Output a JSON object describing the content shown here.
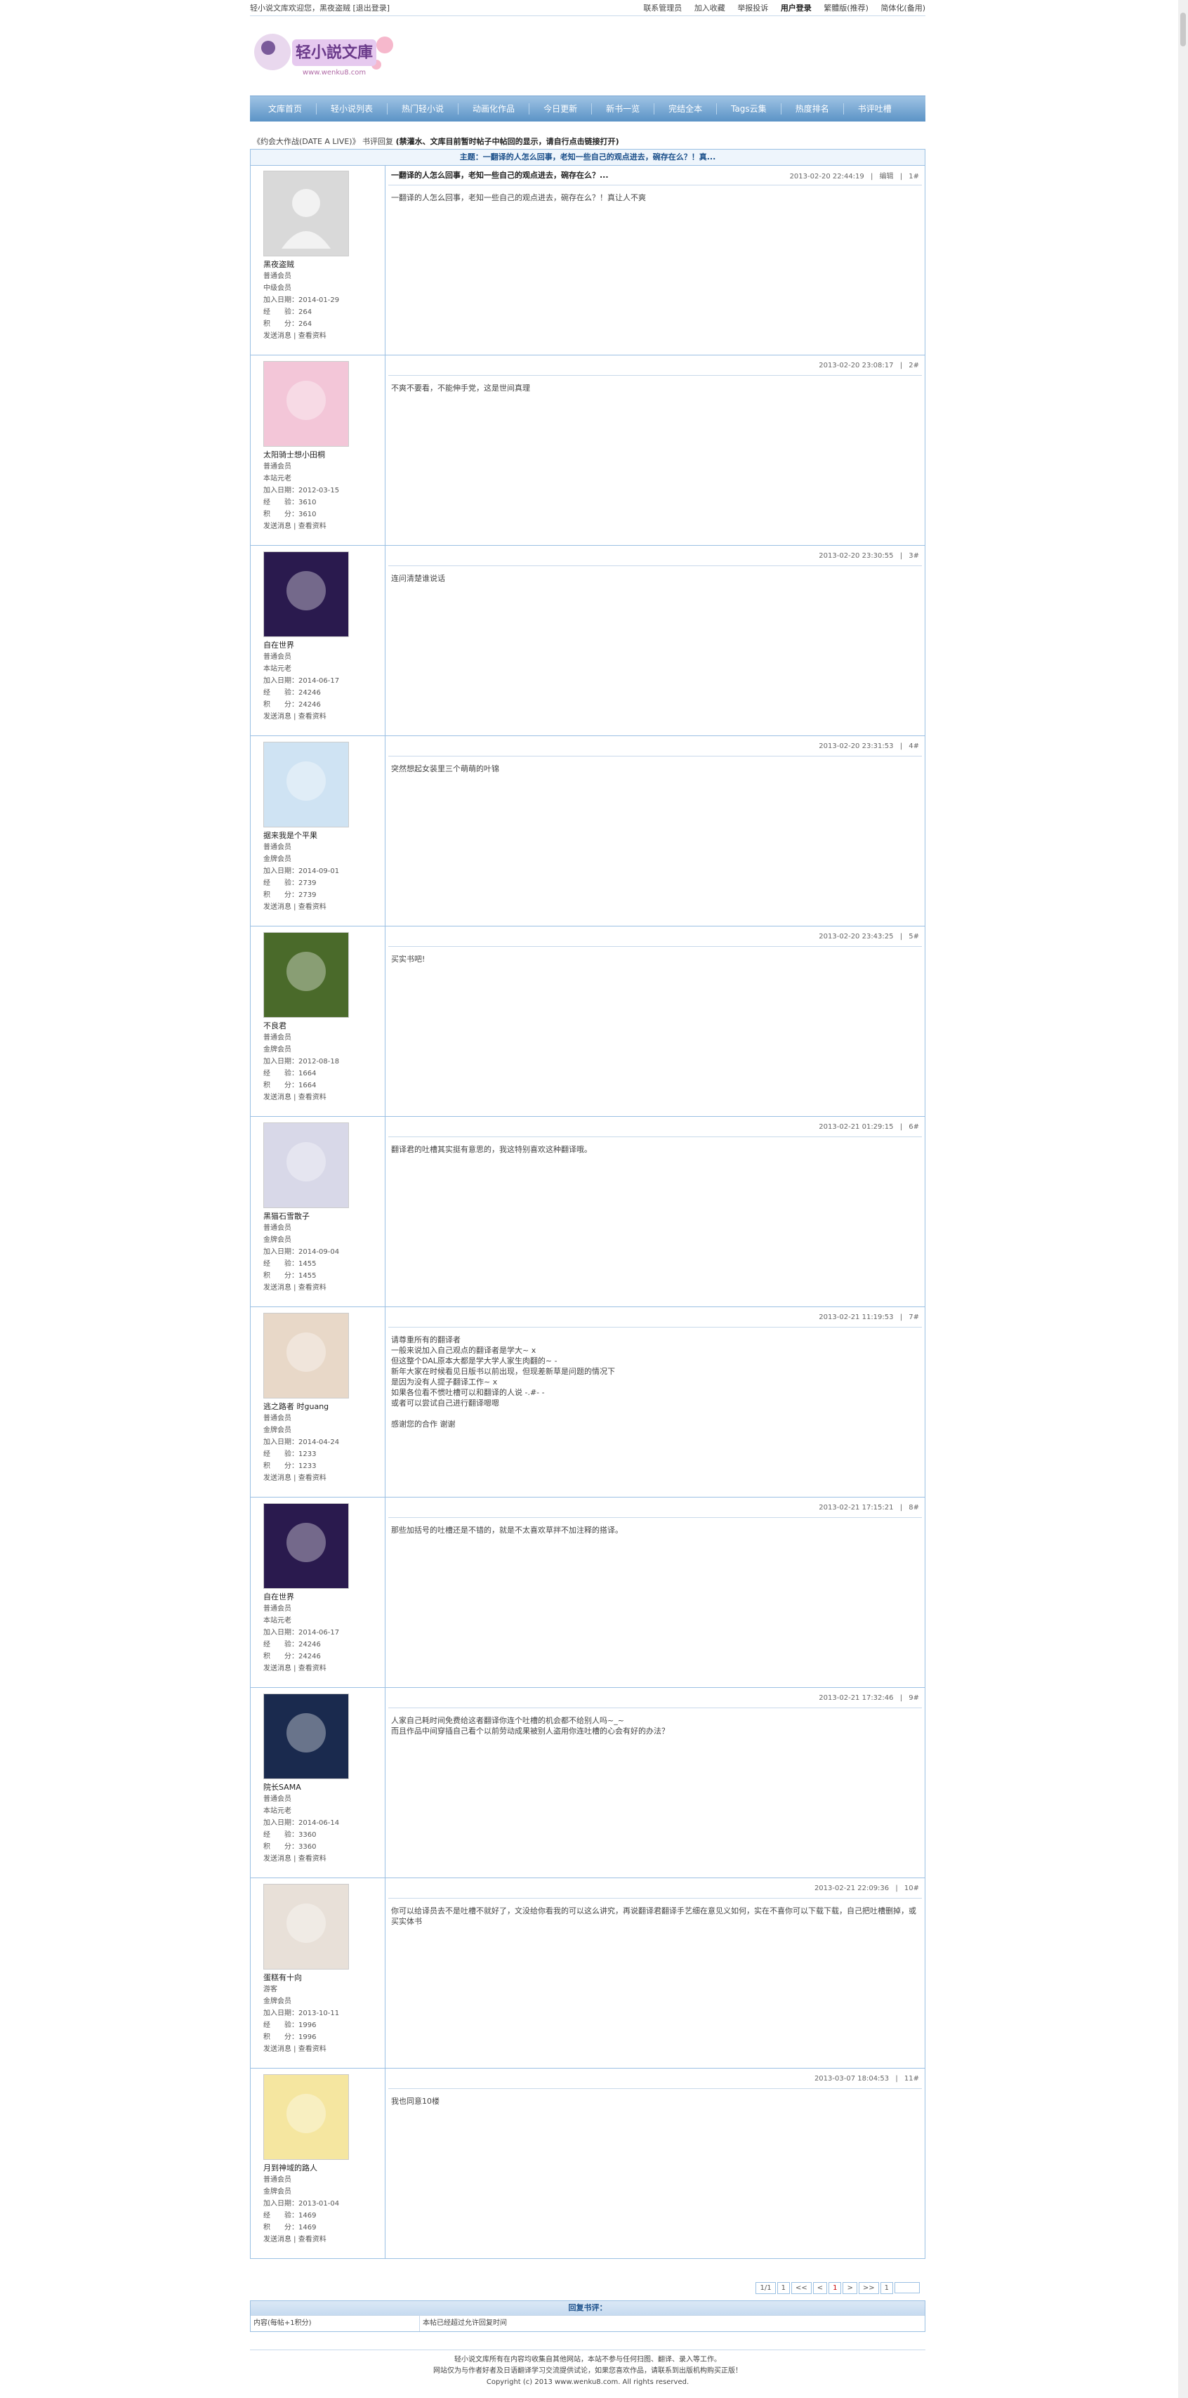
{
  "topbar": {
    "left": "轻小说文库欢迎您，黑夜盗贼 [退出登录]",
    "links": [
      "联系管理员",
      "加入收藏",
      "举报投诉",
      "用户登录",
      "繁體版(推荐)",
      "简体化(备用)"
    ]
  },
  "logo": {
    "text": "轻小说文库",
    "sub": "www.wenku8.com"
  },
  "nav": [
    "文库首页",
    "轻小说列表",
    "热门轻小说",
    "动画化作品",
    "今日更新",
    "新书一览",
    "完结全本",
    "Tags云集",
    "热度排名",
    "书评吐槽"
  ],
  "crumb": {
    "prefix": "《约会大作战(DATE A LIVE)》 书评回复",
    "note": "(禁灌水、文库目前暂时帖子中帖回的显示，请自行点击链接打开)"
  },
  "topic_title": "主题：一翻译的人怎么回事，老知一些自己的观点进去，碗存在么？！真...",
  "posts": [
    {
      "user": "黑夜盗贼",
      "group": "普通会员",
      "level": "中级会员",
      "joined": "2014-01-29",
      "exp": "264",
      "points": "264",
      "time": "2013-02-20 22:44:19",
      "floor": "1#",
      "title": "一翻译的人怎么回事，老知一些自己的观点进去，碗存在么？...",
      "edit": "编辑",
      "content": "一翻译的人怎么回事，老知一些自己的观点进去，碗存在么？！真让人不爽"
    },
    {
      "user": "太阳骑士想小田桐",
      "group": "普通会员",
      "level": "本站元老",
      "joined": "2012-03-15",
      "exp": "3610",
      "points": "3610",
      "time": "2013-02-20 23:08:17",
      "floor": "2#",
      "content": "不爽不要看，不能伸手党，这是世间真理"
    },
    {
      "user": "自在世界",
      "group": "普通会员",
      "level": "本站元老",
      "joined": "2014-06-17",
      "exp": "24246",
      "points": "24246",
      "time": "2013-02-20 23:30:55",
      "floor": "3#",
      "content": "连问清楚谁说话"
    },
    {
      "user": "据来我是个平果",
      "group": "普通会员",
      "level": "金牌会员",
      "joined": "2014-09-01",
      "exp": "2739",
      "points": "2739",
      "time": "2013-02-20 23:31:53",
      "floor": "4#",
      "content": "突然想起女装里三个萌萌的叶锦"
    },
    {
      "user": "不良君",
      "group": "普通会员",
      "level": "金牌会员",
      "joined": "2012-08-18",
      "exp": "1664",
      "points": "1664",
      "time": "2013-02-20 23:43:25",
      "floor": "5#",
      "content": "买实书吧!"
    },
    {
      "user": "黑猫石雪散子",
      "group": "普通会员",
      "level": "金牌会员",
      "joined": "2014-09-04",
      "exp": "1455",
      "points": "1455",
      "time": "2013-02-21 01:29:15",
      "floor": "6#",
      "content": "翻译君的吐槽其实挺有意思的，我这特别喜欢这种翻译哦。"
    },
    {
      "user": "逃之路者 时guang",
      "group": "普通会员",
      "level": "金牌会员",
      "joined": "2014-04-24",
      "exp": "1233",
      "points": "1233",
      "time": "2013-02-21 11:19:53",
      "floor": "7#",
      "content": "请尊重所有的翻译者\n一般来说加入自己观点的翻译者是学大~ x\n但这整个DAL原本大都是学大学人家生肉翻的~ -\n新年大家在时候看见日版书以前出现，但现差新草是问题的情况下\n是因为没有人提子翻译工作~ x\n如果各位看不惯吐槽可以和翻译的人说 -.#- -\n或者可以尝试自己进行翻译嗯嗯\n\n感谢您的合作 谢谢"
    },
    {
      "user": "自在世界",
      "group": "普通会员",
      "level": "本站元老",
      "joined": "2014-06-17",
      "exp": "24246",
      "points": "24246",
      "time": "2013-02-21 17:15:21",
      "floor": "8#",
      "content": "那些加括号的吐槽还是不错的，就是不太喜欢草拌不加注释的搭译。"
    },
    {
      "user": "院长SAMA",
      "group": "普通会员",
      "level": "本站元老",
      "joined": "2014-06-14",
      "exp": "3360",
      "points": "3360",
      "time": "2013-02-21 17:32:46",
      "floor": "9#",
      "content": "人家自己耗时间免费给这者翻译你连个吐槽的机会都不给别人吗~_~\n而且作品中间穿插自己看个以前劳动成果被别人盗用你连吐槽的心会有好的办法？"
    },
    {
      "user": "蛋糕有十向",
      "group": "游客",
      "level": "金牌会员",
      "joined": "2013-10-11",
      "exp": "1996",
      "points": "1996",
      "time": "2013-02-21 22:09:36",
      "floor": "10#",
      "content": "你可以给译员去不是吐槽不就好了，文没给你看我的可以这么讲究，再说翻译君翻译手艺细在意见义如何，实在不喜你可以下载下载，自己把吐槽删掉，或买实体书"
    },
    {
      "user": "月到神域的路人",
      "group": "普通会员",
      "level": "金牌会员",
      "joined": "2013-01-04",
      "exp": "1469",
      "points": "1469",
      "time": "2013-03-07 18:04:53",
      "floor": "11#",
      "content": "我也同意10楼"
    }
  ],
  "labels": {
    "joined": "加入日期：",
    "exp": "经　　验：",
    "points": "积　　分：",
    "send": "发送消息",
    "profile": "查看资料"
  },
  "pager": [
    "1/1",
    "1",
    "<<",
    "<",
    "1",
    ">",
    ">>",
    "1"
  ],
  "reply": {
    "head": "回复书评：",
    "col1": "内容(每帖+1积分)",
    "col2": "本帖已经超过允许回复时间"
  },
  "footer": [
    "轻小说文库所有在内容均收集自其他网站，本站不参与任何扫图、翻译、录入等工作。",
    "网站仅为与作者好者及日语翻译学习交流提供试论，如果您喜欢作品，请联系到出版机构购买正版！",
    "Copyright (c) 2013 www.wenku8.com. All rights reserved."
  ],
  "avatar_colors": [
    "#d9d9d9",
    "#f3c6d8",
    "#2a1a4e",
    "#cfe3f3",
    "#4a6a2a",
    "#d8d8e8",
    "#e8d8c8",
    "#2a1a4e",
    "#1a2a4e",
    "#e8e0d8",
    "#f5e6a0"
  ]
}
